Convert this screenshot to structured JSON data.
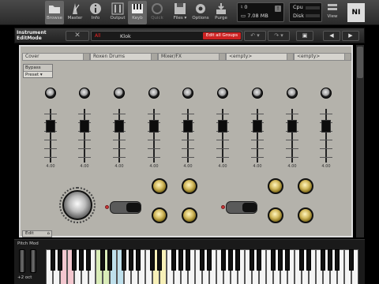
{
  "toolbar": {
    "buttons": [
      {
        "label": "Browse",
        "icon": "folder-icon",
        "active": true
      },
      {
        "label": "Master",
        "icon": "metronome-icon",
        "active": false
      },
      {
        "label": "Info",
        "icon": "info-icon",
        "active": false
      },
      {
        "label": "Output",
        "icon": "output-icon",
        "active": false
      },
      {
        "label": "Keyb",
        "icon": "keyboard-icon",
        "active": true
      },
      {
        "label": "Quick",
        "icon": "quick-icon",
        "active": false
      },
      {
        "label": "Files ▾",
        "icon": "disk-icon",
        "active": false
      },
      {
        "label": "Options",
        "icon": "gear-icon",
        "active": false
      },
      {
        "label": "Purge",
        "icon": "purge-icon",
        "active": false
      }
    ],
    "voices": "0",
    "memory": "7.08 MB",
    "cpu_label": "Cpu",
    "disk_label": "Disk",
    "view_label": "View"
  },
  "instrument": {
    "mode_line1": "Instrument",
    "mode_line2": "EditMode",
    "abbrev": "All",
    "name": "Klok",
    "edit_all_groups": "Edit all Groups"
  },
  "tabs": [
    "Cover",
    "Roxen Drums",
    "Mixer/FX",
    "<empty>",
    "<empty>"
  ],
  "active_tab": "Mixer/FX",
  "bypass_label": "Bypass",
  "preset_label": "Preset ▾",
  "channels": [
    {
      "value": "4.00"
    },
    {
      "value": "4.00"
    },
    {
      "value": "4.00"
    },
    {
      "value": "4.00"
    },
    {
      "value": "4.00"
    },
    {
      "value": "4.00"
    },
    {
      "value": "4.00"
    },
    {
      "value": "4.00"
    },
    {
      "value": "4.00"
    }
  ],
  "edit_label": "Edit",
  "keyboard": {
    "label": "Pitch Mod",
    "octave": "+2 oct"
  },
  "colors": {
    "panel": "#b4b2ab",
    "accent_red": "#cc2222",
    "gold": "#d4bb60"
  }
}
